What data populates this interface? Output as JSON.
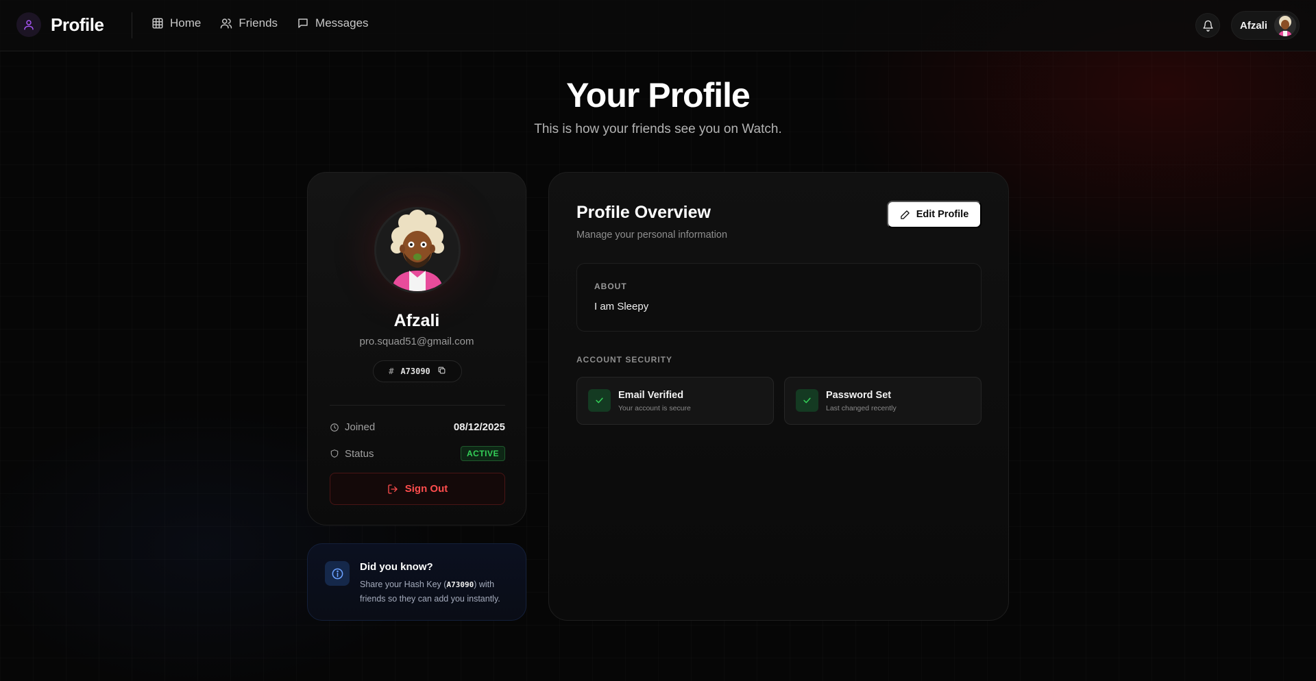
{
  "brand": {
    "title": "Profile",
    "icon": "user-icon",
    "accent": "#a855f7"
  },
  "nav": {
    "items": [
      {
        "label": "Home",
        "icon": "grid-icon"
      },
      {
        "label": "Friends",
        "icon": "users-icon"
      },
      {
        "label": "Messages",
        "icon": "message-icon"
      }
    ]
  },
  "user_menu": {
    "name": "Afzali",
    "notifications_icon": "bell-icon"
  },
  "header": {
    "title": "Your Profile",
    "subtitle": "This is how your friends see you on Watch."
  },
  "profile_card": {
    "name": "Afzali",
    "email": "pro.squad51@gmail.com",
    "hash_symbol": "#",
    "hash_key": "A73090",
    "joined_label": "Joined",
    "joined_value": "08/12/2025",
    "status_label": "Status",
    "status_value": "ACTIVE",
    "status_color": "#34d058",
    "sign_out_label": "Sign Out",
    "danger_color": "#ff4d4d"
  },
  "info": {
    "title": "Did you know?",
    "text_before": "Share your Hash Key (",
    "code": "A73090",
    "text_after": ") with friends so they can add you instantly."
  },
  "overview": {
    "title": "Profile Overview",
    "subtitle": "Manage your personal information",
    "edit_label": "Edit Profile",
    "about_label": "ABOUT",
    "about_text": "I am Sleepy",
    "security_label": "ACCOUNT SECURITY",
    "security_items": [
      {
        "title": "Email Verified",
        "subtitle": "Your account is secure"
      },
      {
        "title": "Password Set",
        "subtitle": "Last changed recently"
      }
    ]
  }
}
